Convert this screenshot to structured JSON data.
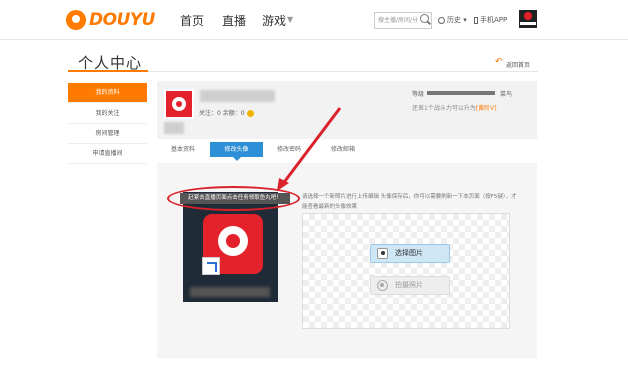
{
  "header": {
    "logo_text": "DOUYU",
    "nav": {
      "home": "首页",
      "live": "直播",
      "games": "游戏"
    },
    "search_placeholder": "搜主播/房间/分",
    "history_label": "历史",
    "mobile_label": "手机APP"
  },
  "page": {
    "title": "个人中心",
    "back_label": "返回首页"
  },
  "sidebar": {
    "items": [
      {
        "label": "我的资料"
      },
      {
        "label": "我的关注"
      },
      {
        "label": "房间管理"
      },
      {
        "label": "申请直播间"
      }
    ]
  },
  "profile": {
    "stats": "关注：0  余额：0",
    "level_label": "等级",
    "level_name": "菜鸟",
    "upgrade_tip": "还差1个战斗力可以升为",
    "upgrade_target": "[黄阶V]"
  },
  "tabs": [
    {
      "label": "基本资料"
    },
    {
      "label": "修改头像"
    },
    {
      "label": "修改密码"
    },
    {
      "label": "修改邮箱"
    }
  ],
  "avatar_editor": {
    "callout": "赶紧去直播页面点击任务领取鱼丸吧！",
    "instructions": "请选择一个新照片进行上传编辑 头像保存后，你可以需要刷新一下本页面（按F5键），才能查看最新的头像效果",
    "choose_label": "选择图片",
    "photo_label": "拍摄照片"
  },
  "colors": {
    "accent": "#ff7a00",
    "tab_active": "#2d8fd5",
    "annotation": "#d9222a"
  }
}
